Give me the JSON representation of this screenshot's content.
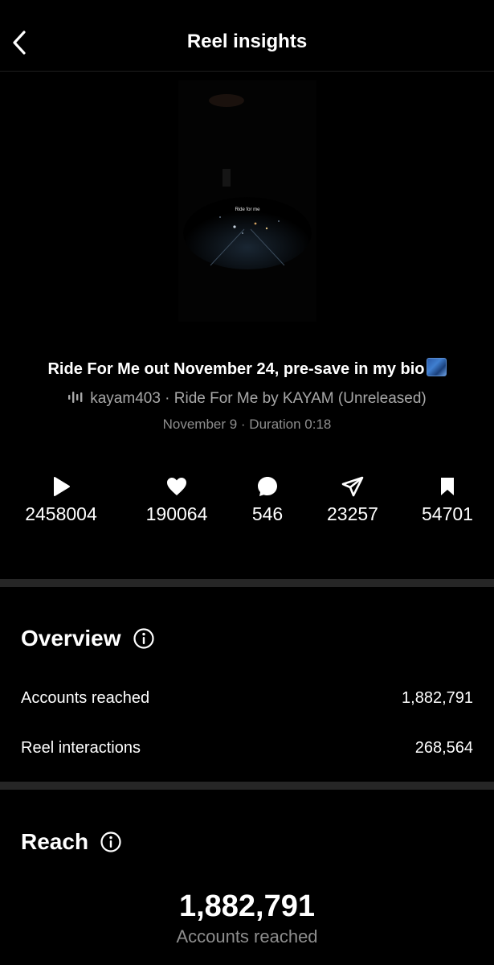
{
  "header": {
    "title": "Reel insights"
  },
  "thumbnail": {
    "overlay_text": "Ride for me"
  },
  "post": {
    "caption": "Ride For Me out November 24, pre-save in my bio",
    "audio": "kayam403 · Ride For Me by KAYAM (Unreleased)",
    "meta": "November 9 · Duration 0:18"
  },
  "stats": {
    "plays": "2458004",
    "likes": "190064",
    "comments": "546",
    "shares": "23257",
    "saves": "54701"
  },
  "overview": {
    "title": "Overview",
    "rows": [
      {
        "label": "Accounts reached",
        "value": "1,882,791"
      },
      {
        "label": "Reel interactions",
        "value": "268,564"
      }
    ]
  },
  "reach": {
    "title": "Reach",
    "value": "1,882,791",
    "label": "Accounts reached"
  }
}
